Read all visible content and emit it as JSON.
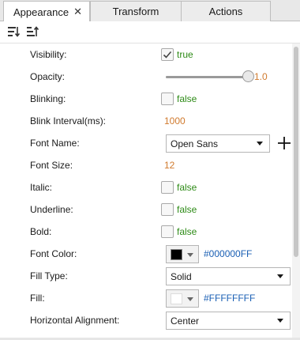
{
  "tabs": [
    {
      "label": "Appearance",
      "active": true,
      "closable": true
    },
    {
      "label": "Transform",
      "active": false
    },
    {
      "label": "Actions",
      "active": false
    }
  ],
  "tab_close_glyph": "✕",
  "toolbar": {
    "buttons": [
      {
        "icon": "sort-descending-icon"
      },
      {
        "icon": "sort-ascending-icon"
      }
    ]
  },
  "properties": {
    "visibility": {
      "label": "Visibility:",
      "checked": true,
      "value": "true"
    },
    "opacity": {
      "label": "Opacity:",
      "value": "1.0",
      "level": 1.0
    },
    "blinking": {
      "label": "Blinking:",
      "checked": false,
      "value": "false"
    },
    "blink_interval": {
      "label": "Blink Interval(ms):",
      "value": "1000"
    },
    "font_name": {
      "label": "Font Name:",
      "value": "Open Sans"
    },
    "font_size": {
      "label": "Font Size:",
      "value": "12"
    },
    "italic": {
      "label": "Italic:",
      "checked": false,
      "value": "false"
    },
    "underline": {
      "label": "Underline:",
      "checked": false,
      "value": "false"
    },
    "bold": {
      "label": "Bold:",
      "checked": false,
      "value": "false"
    },
    "font_color": {
      "label": "Font Color:",
      "hex": "#000000FF",
      "swatch": "#000000"
    },
    "fill_type": {
      "label": "Fill Type:",
      "value": "Solid"
    },
    "fill": {
      "label": "Fill:",
      "hex": "#FFFFFFFF",
      "swatch": "#FFFFFF"
    },
    "horizontal_alignment": {
      "label": "Horizontal Alignment:",
      "value": "Center"
    }
  },
  "colors": {
    "bool_green": "#2e8b17",
    "number_orange": "#d07a2e",
    "hex_blue": "#1a5fb4"
  }
}
